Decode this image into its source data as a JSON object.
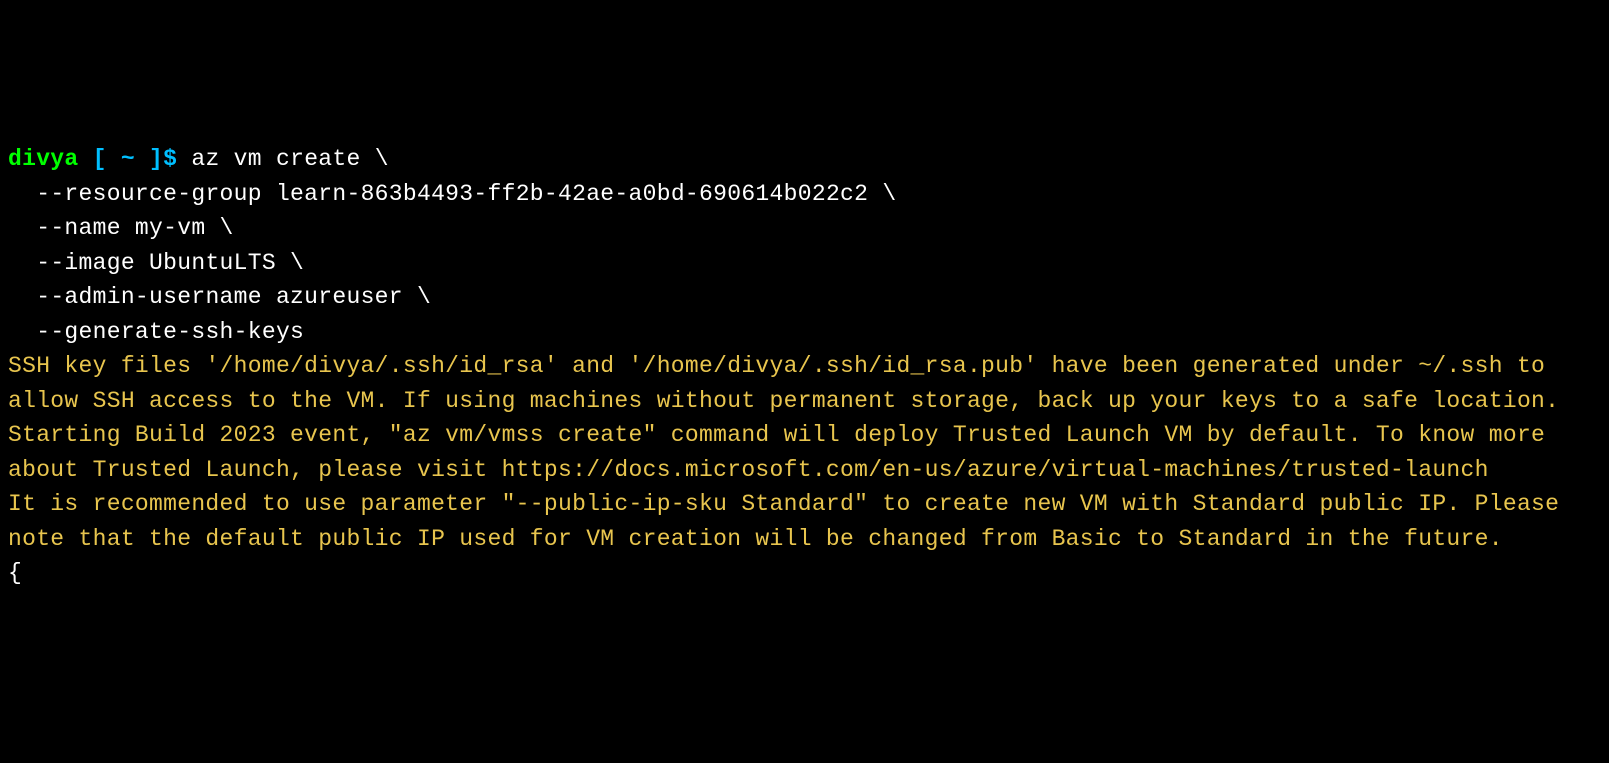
{
  "prompt": {
    "user": "divya",
    "lbracket": " [ ",
    "path": "~",
    "rbracket": " ]",
    "sigil": "$ "
  },
  "cmd": {
    "l1": "az vm create \\",
    "l2": "  --resource-group learn-863b4493-ff2b-42ae-a0bd-690614b022c2 \\",
    "l3": "  --name my-vm \\",
    "l4": "  --image UbuntuLTS \\",
    "l5": "  --admin-username azureuser \\",
    "l6": "  --generate-ssh-keys"
  },
  "out": {
    "w1": "SSH key files '/home/divya/.ssh/id_rsa' and '/home/divya/.ssh/id_rsa.pub' have been generated under ~/.ssh to allow SSH access to the VM. If using machines without permanent storage, back up your keys to a safe location.",
    "w2": "Starting Build 2023 event, \"az vm/vmss create\" command will deploy Trusted Launch VM by default. To know more about Trusted Launch, please visit https://docs.microsoft.com/en-us/azure/virtual-machines/trusted-launch",
    "w3": "It is recommended to use parameter \"--public-ip-sku Standard\" to create new VM with Standard public IP. Please note that the default public IP used for VM creation will be changed from Basic to Standard in the future.",
    "json_start": "{"
  }
}
